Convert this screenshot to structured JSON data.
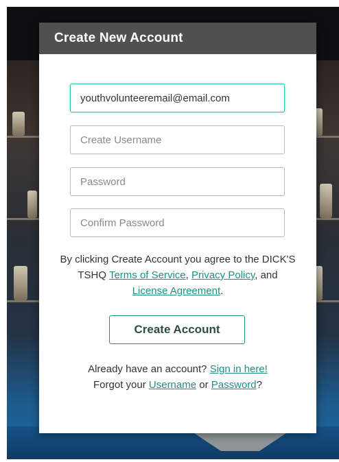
{
  "modal": {
    "title": "Create New Account"
  },
  "form": {
    "email_value": "youthvolunteeremail@email.com",
    "username_placeholder": "Create Username",
    "password_placeholder": "Password",
    "confirm_password_placeholder": "Confirm Password"
  },
  "terms": {
    "prefix": "By clicking Create Account you agree to the DICK'S TSHQ ",
    "terms_link": "Terms of Service",
    "sep1": ", ",
    "privacy_link": "Privacy Policy",
    "sep2": ",  and ",
    "license_link": "License Agreement",
    "suffix": "."
  },
  "buttons": {
    "create_account": "Create Account"
  },
  "footer": {
    "already_text": "Already have an account? ",
    "sign_in_link": "Sign in here!",
    "forgot_text": "Forgot your ",
    "username_link": "Username",
    "or_text": " or ",
    "password_link": "Password",
    "question_mark": "?"
  },
  "colors": {
    "header_bg": "#505050",
    "link": "#1f8f86",
    "focus_border": "#2bc4b3"
  }
}
